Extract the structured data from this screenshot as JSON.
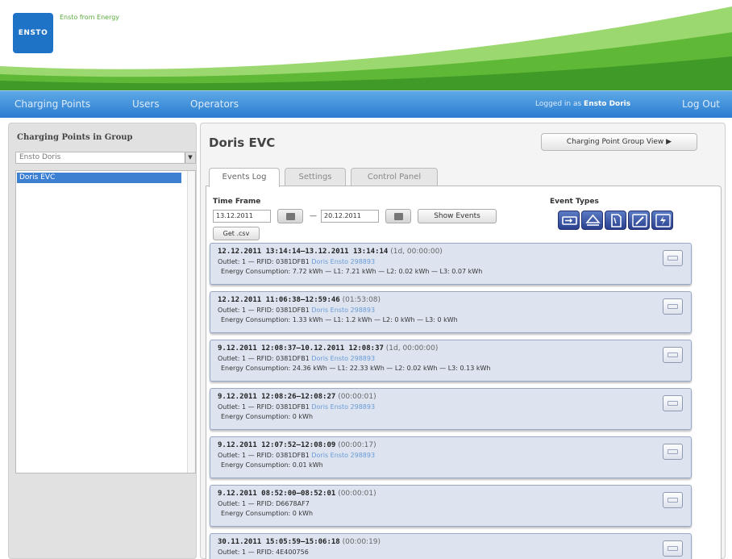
{
  "header": {
    "logo_text": "ENSTO",
    "tagline": "Ensto from Energy"
  },
  "nav": {
    "items": [
      "Charging Points",
      "Users",
      "Operators"
    ],
    "logged_in_prefix": "Logged in as",
    "user_name": "Ensto Doris",
    "logout": "Log Out"
  },
  "left_panel": {
    "title": "Charging Points in Group",
    "group_select": "Ensto Doris",
    "list_items": [
      "Doris EVC"
    ]
  },
  "main": {
    "title": "Doris EVC",
    "group_view_button": "Charging Point Group View ▶",
    "tabs": [
      "Events Log",
      "Settings",
      "Control Panel"
    ],
    "time_frame_label": "Time Frame",
    "date_from": "13.12.2011",
    "date_to": "20.12.2011",
    "date_separator": "—",
    "show_events": "Show Events",
    "get_csv": "Get .csv",
    "event_types_label": "Event Types",
    "event_type_icons": [
      "plug-in-icon",
      "eject-icon",
      "document-icon",
      "edit-icon",
      "power-icon"
    ]
  },
  "events": [
    {
      "timespan": "12.12.2011 13:14:14–13.12.2011 13:14:14",
      "duration": "(1d, 00:00:00)",
      "outlet": "Outlet: 1 — RFID: 0381DFB1",
      "rfid_owner": "Doris Ensto 298893",
      "energy": "Energy Consumption: 7.72 kWh — L1: 7.21 kWh — L2: 0.02 kWh — L3: 0.07 kWh"
    },
    {
      "timespan": "12.12.2011 11:06:38–12:59:46",
      "duration": "(01:53:08)",
      "outlet": "Outlet: 1 — RFID: 0381DFB1",
      "rfid_owner": "Doris Ensto 298893",
      "energy": "Energy Consumption: 1.33 kWh — L1: 1.2 kWh — L2: 0 kWh — L3: 0 kWh"
    },
    {
      "timespan": "9.12.2011 12:08:37–10.12.2011 12:08:37",
      "duration": "(1d, 00:00:00)",
      "outlet": "Outlet: 1 — RFID: 0381DFB1",
      "rfid_owner": "Doris Ensto 298893",
      "energy": "Energy Consumption: 24.36 kWh — L1: 22.33 kWh — L2: 0.02 kWh — L3: 0.13 kWh"
    },
    {
      "timespan": "9.12.2011 12:08:26–12:08:27",
      "duration": "(00:00:01)",
      "outlet": "Outlet: 1 — RFID: 0381DFB1",
      "rfid_owner": "Doris Ensto 298893",
      "energy": "Energy Consumption: 0 kWh"
    },
    {
      "timespan": "9.12.2011 12:07:52–12:08:09",
      "duration": "(00:00:17)",
      "outlet": "Outlet: 1 — RFID: 0381DFB1",
      "rfid_owner": "Doris Ensto 298893",
      "energy": "Energy Consumption: 0.01 kWh"
    },
    {
      "timespan": "9.12.2011 08:52:00–08:52:01",
      "duration": "(00:00:01)",
      "outlet": "Outlet: 1 — RFID: D6678AF7",
      "rfid_owner": "",
      "energy": "Energy Consumption: 0 kWh"
    },
    {
      "timespan": "30.11.2011 15:05:59–15:06:18",
      "duration": "(00:00:19)",
      "outlet": "Outlet: 1 — RFID: 4E400756",
      "rfid_owner": "",
      "energy": ""
    }
  ],
  "colors": {
    "nav_blue": "#2b7cd1",
    "brand_green": "#6cc04a",
    "event_bg": "#dde4f0"
  }
}
